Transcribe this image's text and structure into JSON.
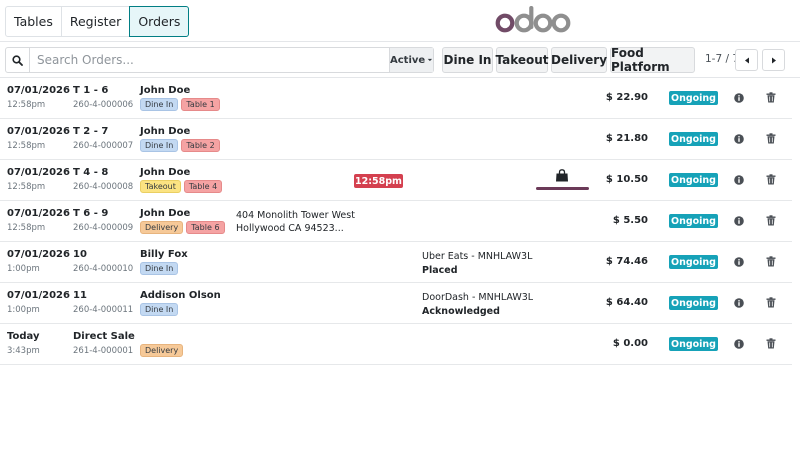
{
  "nav": {
    "tabs": [
      {
        "label": "Tables",
        "active": false
      },
      {
        "label": "Register",
        "active": false
      },
      {
        "label": "Orders",
        "active": true
      }
    ]
  },
  "brand": {
    "logo": "odoo",
    "color": "#714b67",
    "icon_color": "#8f8f8f"
  },
  "search": {
    "placeholder": "Search Orders...",
    "value": "",
    "icon": "search-icon"
  },
  "filter": {
    "label": "Active",
    "icon": "caret-down-icon"
  },
  "type_buttons": [
    {
      "label": "Dine In"
    },
    {
      "label": "Takeout"
    },
    {
      "label": "Delivery"
    },
    {
      "label": "Food Platform"
    }
  ],
  "pager": {
    "label": "1-7 / 7",
    "prev_icon": "chevron-left-icon",
    "next_icon": "chevron-right-icon"
  },
  "colors": {
    "ongoing": "#16a2b8",
    "late_timer": "#d4404f",
    "accent": "#017e84",
    "prep": "#6b3a58"
  },
  "orders": [
    {
      "date": "07/01/2026",
      "time": "12:58pm",
      "table": "T 1 - 6",
      "ref": "260-4-000006",
      "customer": "John Doe",
      "tags": [
        {
          "label": "Dine In",
          "kind": "dinein"
        },
        {
          "label": "Table 1",
          "kind": "table"
        }
      ],
      "total": "$ 22.90",
      "status": "Ongoing"
    },
    {
      "date": "07/01/2026",
      "time": "12:58pm",
      "table": "T 2 - 7",
      "ref": "260-4-000007",
      "customer": "John Doe",
      "tags": [
        {
          "label": "Dine In",
          "kind": "dinein"
        },
        {
          "label": "Table 2",
          "kind": "table"
        }
      ],
      "total": "$ 21.80",
      "status": "Ongoing"
    },
    {
      "date": "07/01/2026",
      "time": "12:58pm",
      "table": "T 4 - 8",
      "ref": "260-4-000008",
      "customer": "John Doe",
      "tags": [
        {
          "label": "Takeout",
          "kind": "takeout"
        },
        {
          "label": "Table 4",
          "kind": "table"
        }
      ],
      "timer": "12:58pm",
      "preparation_icon": "shopping-bag-icon",
      "total": "$ 10.50",
      "status": "Ongoing"
    },
    {
      "date": "07/01/2026",
      "time": "12:58pm",
      "table": "T 6 - 9",
      "ref": "260-4-000009",
      "customer": "John Doe",
      "tags": [
        {
          "label": "Delivery",
          "kind": "delivery"
        },
        {
          "label": "Table 6",
          "kind": "table"
        }
      ],
      "address_line1": "404 Monolith Tower West",
      "address_line2": "Hollywood CA 94523...",
      "total": "$ 5.50",
      "status": "Ongoing"
    },
    {
      "date": "07/01/2026",
      "time": "1:00pm",
      "table": "10",
      "ref": "260-4-000010",
      "customer": "Billy Fox",
      "tags": [
        {
          "label": "Dine In",
          "kind": "dinein"
        }
      ],
      "platform": "Uber Eats - MNHLAW3L",
      "platform_status": "Placed",
      "total": "$ 74.46",
      "status": "Ongoing"
    },
    {
      "date": "07/01/2026",
      "time": "1:00pm",
      "table": "11",
      "ref": "260-4-000011",
      "customer": "Addison Olson",
      "tags": [
        {
          "label": "Dine In",
          "kind": "dinein"
        }
      ],
      "platform": "DoorDash - MNHLAW3L",
      "platform_status": "Acknowledged",
      "total": "$ 64.40",
      "status": "Ongoing"
    },
    {
      "date": "Today",
      "time": "3:43pm",
      "table": "Direct Sale",
      "ref": "261-4-000001",
      "customer": "",
      "tags": [
        {
          "label": "Delivery",
          "kind": "delivery"
        }
      ],
      "total": "$ 0.00",
      "status": "Ongoing"
    }
  ]
}
